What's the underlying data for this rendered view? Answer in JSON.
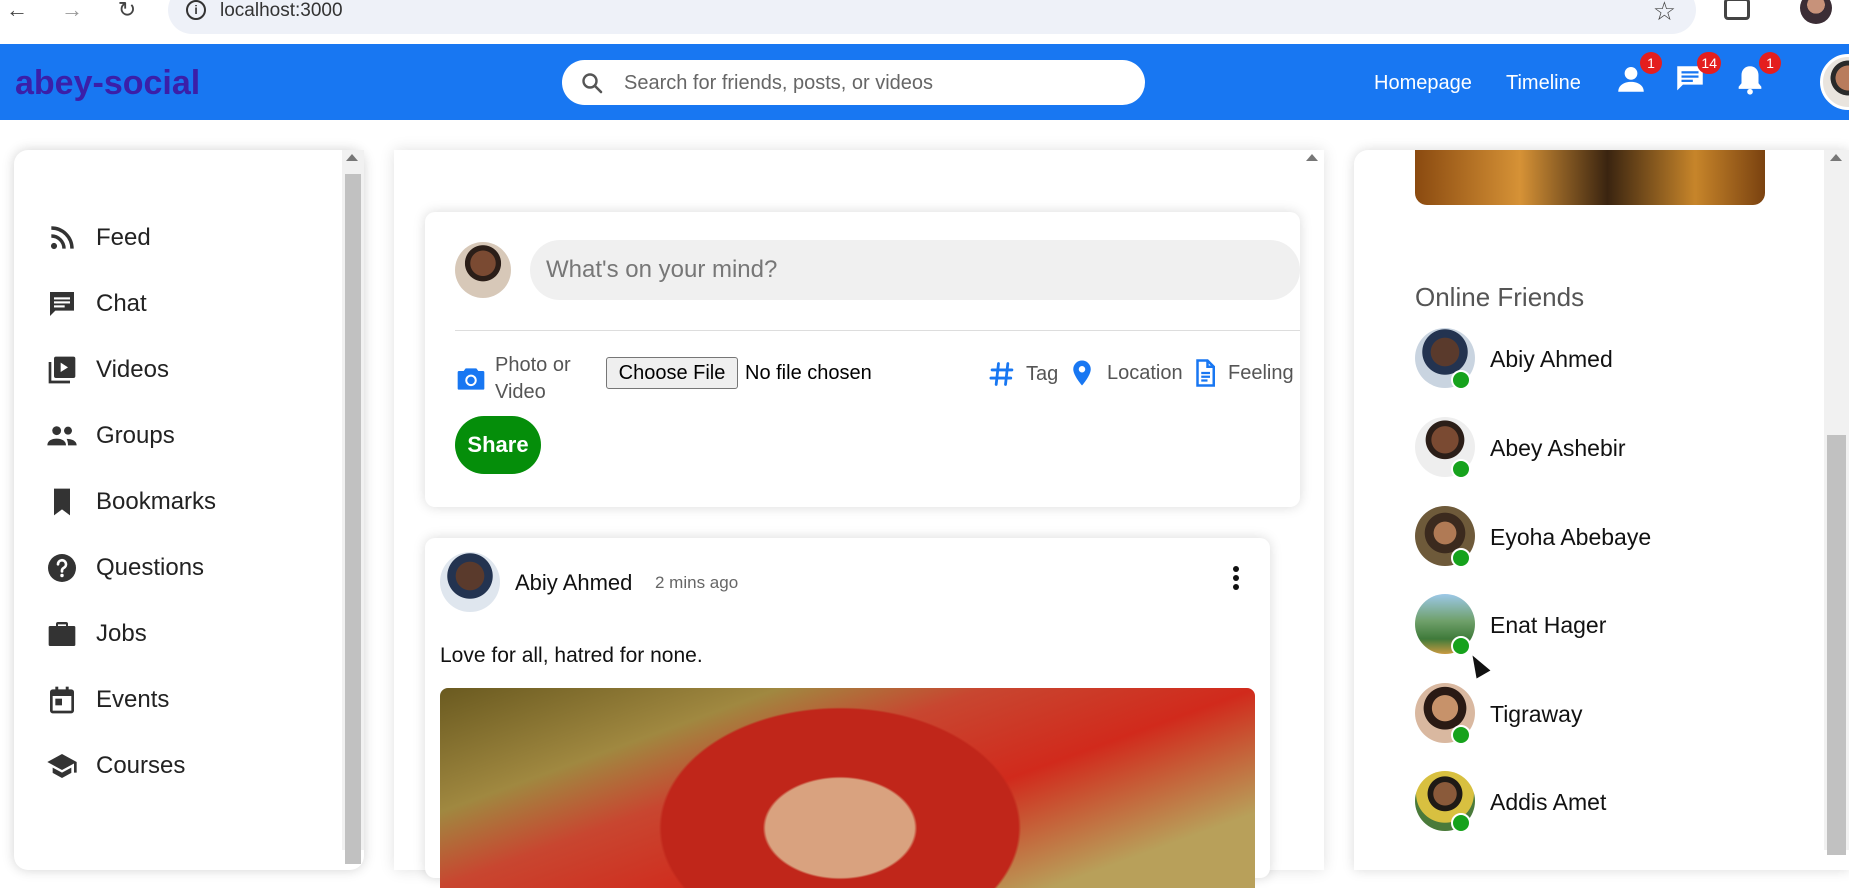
{
  "browser": {
    "url": "localhost:3000",
    "back_icon": "arrow-left-icon",
    "forward_icon": "arrow-right-icon",
    "reload_icon": "reload-icon",
    "info_icon": "info-icon",
    "star_icon": "star-icon",
    "extensions_icon": "puzzle-icon"
  },
  "header": {
    "logo": "abey-social",
    "search_placeholder": "Search for friends, posts, or videos",
    "links": [
      "Homepage",
      "Timeline"
    ],
    "badges": {
      "friends": "1",
      "messages": "14",
      "notifications": "1"
    },
    "colors": {
      "bar": "#1877f2",
      "logo": "#3b1fa8",
      "badge": "#e41e1e"
    }
  },
  "sidebar": {
    "items": [
      {
        "label": "Feed",
        "icon": "rss-icon"
      },
      {
        "label": "Chat",
        "icon": "chat-icon"
      },
      {
        "label": "Videos",
        "icon": "video-library-icon"
      },
      {
        "label": "Groups",
        "icon": "groups-icon"
      },
      {
        "label": "Bookmarks",
        "icon": "bookmark-icon"
      },
      {
        "label": "Questions",
        "icon": "help-icon"
      },
      {
        "label": "Jobs",
        "icon": "briefcase-icon"
      },
      {
        "label": "Events",
        "icon": "calendar-icon"
      },
      {
        "label": "Courses",
        "icon": "school-icon"
      }
    ]
  },
  "share": {
    "placeholder": "What's on your mind?",
    "photo_label_line1": "Photo or",
    "photo_label_line2": "Video",
    "file_button": "Choose File",
    "file_status": "No file chosen",
    "tag": "Tag",
    "location": "Location",
    "feeling": "Feeling",
    "share_button": "Share",
    "colors": {
      "share_button": "#058e0a",
      "icons": "#1877f2"
    }
  },
  "post": {
    "author": "Abiy Ahmed",
    "time": "2 mins ago",
    "text": "Love for all, hatred for none."
  },
  "rightbar": {
    "title": "Online Friends",
    "friends": [
      {
        "name": "Abiy Ahmed"
      },
      {
        "name": "Abey Ashebir"
      },
      {
        "name": "Eyoha Abebaye"
      },
      {
        "name": "Enat Hager"
      },
      {
        "name": "Tigraway"
      },
      {
        "name": "Addis Amet"
      }
    ],
    "online_color": "#16a21c"
  }
}
